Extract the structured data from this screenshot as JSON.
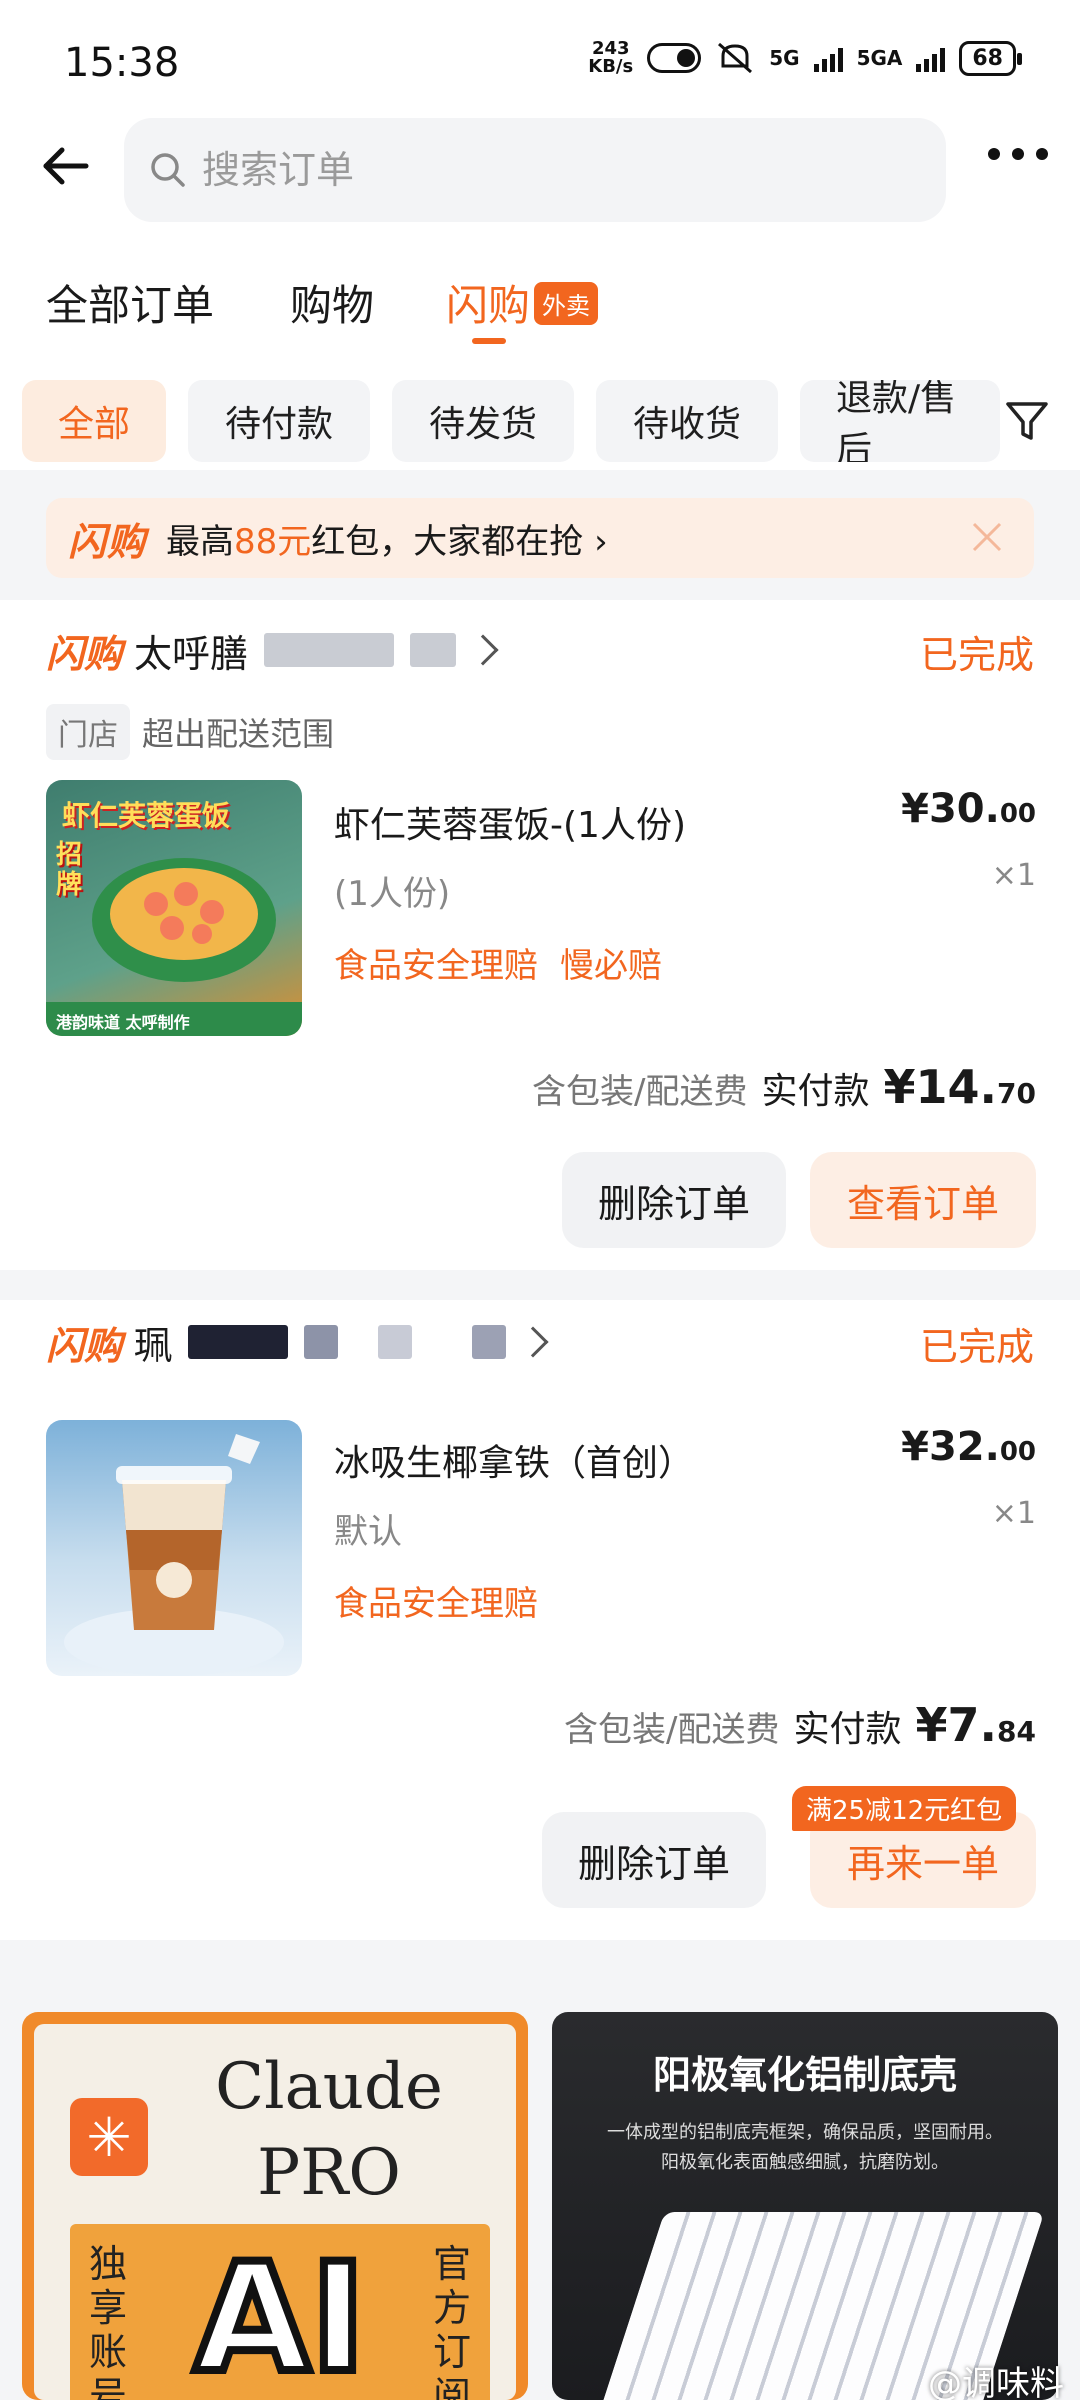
{
  "status_bar": {
    "time": "15:38",
    "net_speed_value": "243",
    "net_speed_unit": "KB/s",
    "signal1": "5G",
    "signal2": "5GA",
    "battery": "68"
  },
  "search": {
    "placeholder": "搜索订单"
  },
  "main_tabs": [
    {
      "label": "全部订单"
    },
    {
      "label": "购物"
    },
    {
      "label": "闪购",
      "badge": "外卖"
    }
  ],
  "filter_chips": [
    {
      "label": "全部"
    },
    {
      "label": "待付款"
    },
    {
      "label": "待发货"
    },
    {
      "label": "待收货"
    },
    {
      "label": "退款/售后"
    }
  ],
  "promo": {
    "brand": "闪购",
    "text_prefix": "最高",
    "amount": "88元",
    "text_suffix": "红包，大家都在抢 ›"
  },
  "orders": [
    {
      "brand": "闪购",
      "store_name": "太呼膳",
      "status": "已完成",
      "store_tag": "门店",
      "store_meta": "超出配送范围",
      "thumb_title": "虾仁芙蓉蛋饭",
      "thumb_badge": "招牌",
      "thumb_footer": "港韵味道 太呼制作",
      "item_name": "虾仁芙蓉蛋饭-(1人份)",
      "item_spec": "(1人份)",
      "item_tags": [
        "食品安全理赔",
        "慢必赔"
      ],
      "price_main": "¥30.",
      "price_cents": "00",
      "qty": "×1",
      "fee_label": "含包装/配送费",
      "paid_label": "实付款",
      "paid_main": "¥14.",
      "paid_cents": "70",
      "buttons": [
        "删除订单",
        "查看订单"
      ]
    },
    {
      "brand": "闪购",
      "store_name": "珮",
      "status": "已完成",
      "item_name": "冰吸生椰拿铁（首创）",
      "item_spec": "默认",
      "item_tags": [
        "食品安全理赔"
      ],
      "price_main": "¥32.",
      "price_cents": "00",
      "qty": "×1",
      "fee_label": "含包装/配送费",
      "paid_label": "实付款",
      "paid_main": "¥7.",
      "paid_cents": "84",
      "buttons": [
        "删除订单",
        "再来一单"
      ],
      "button_badge": "满25减12元红包"
    }
  ],
  "ads": [
    {
      "title_line1": "Claude",
      "title_line2": "PRO",
      "ai_text": "AI",
      "left_side": "独享账号",
      "right_side": "官方订阅"
    },
    {
      "headline": "阳极氧化铝制底壳",
      "sub1": "一体成型的铝制底壳框架，确保品质，坚固耐用。",
      "sub2": "阳极氧化表面触感细腻，抗磨防划。"
    }
  ],
  "watermark": "@调味料"
}
